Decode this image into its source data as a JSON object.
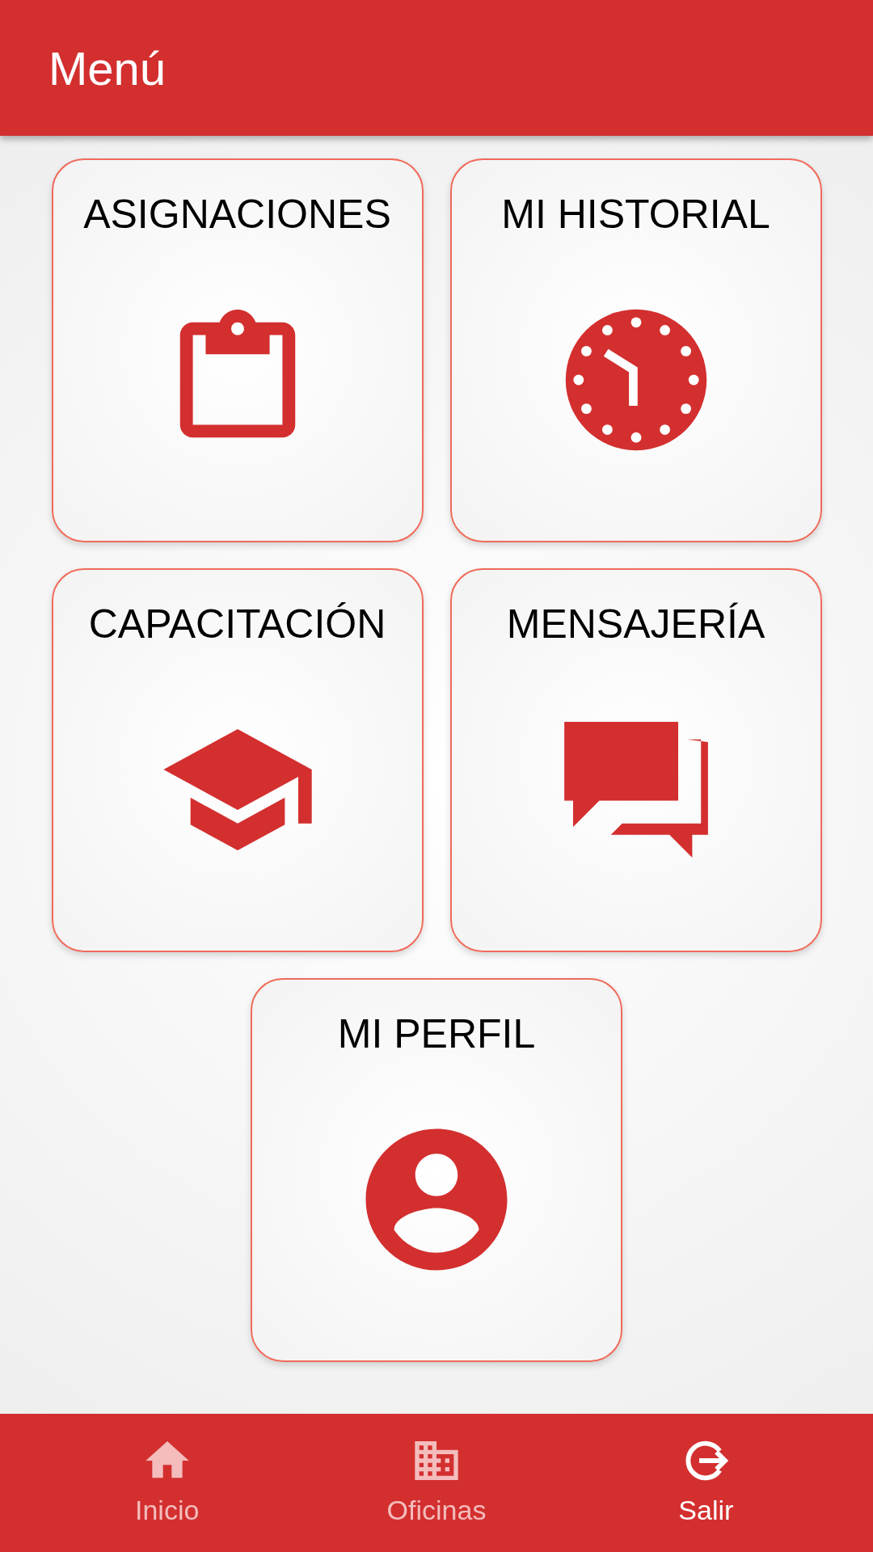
{
  "app_bar": {
    "title": "Menú"
  },
  "tiles": [
    {
      "label": "ASIGNACIONES",
      "kind": "clipboard"
    },
    {
      "label": "MI HISTORIAL",
      "kind": "clock"
    },
    {
      "label": "CAPACITACIÓN",
      "kind": "cap"
    },
    {
      "label": "MENSAJERÍA",
      "kind": "chat"
    },
    {
      "label": "MI PERFIL",
      "kind": "profile"
    }
  ],
  "bottom_nav": [
    {
      "label": "Inicio",
      "kind": "home",
      "selected": false
    },
    {
      "label": "Oficinas",
      "kind": "building",
      "selected": false
    },
    {
      "label": "Salir",
      "kind": "logout",
      "selected": true
    }
  ]
}
